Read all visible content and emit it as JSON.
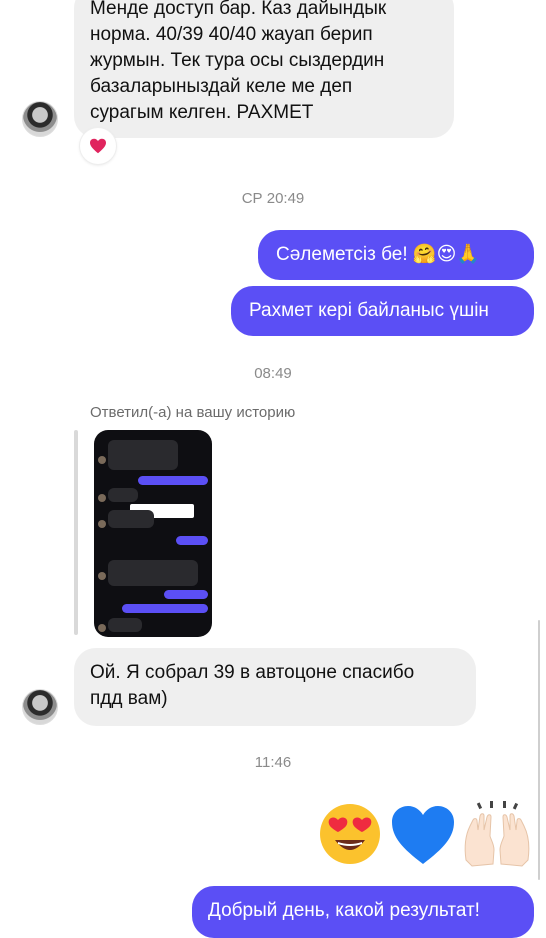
{
  "messages": {
    "first_text_lines": [
      "Менде доступ бар. Каз дайындык",
      "норма. 40/39 40/40 жауап берип",
      "журмын. Тек тура осы сыздердин",
      "базаларыныздай келе ме деп",
      "сурагым келген. РАХМЕТ"
    ],
    "first_reaction": "heart",
    "time1": "СР 20:49",
    "out1": "Сәлеметсіз бе! 🤗😍🙏",
    "out2": "Рахмет кері байланыс үшін",
    "time2": "08:49",
    "story_caption": "Ответил(-а) на вашу историю",
    "reply_text_line1": "Ой. Я собрал 39 в автоцоне спасибо",
    "reply_text_line2": "пдд вам)",
    "time3": "11:46",
    "big_emojis": [
      "heart-eyes",
      "blue-heart",
      "raising-hands"
    ],
    "out_last": "Добрый день, какой результат!"
  },
  "colors": {
    "outgoing_bubble": "#5b4ff5",
    "incoming_bubble": "#efefef",
    "timestamp": "#8a8a8a"
  }
}
